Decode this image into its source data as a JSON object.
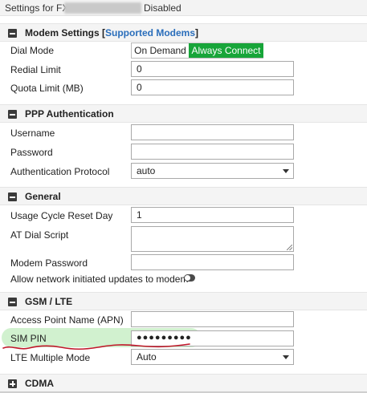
{
  "window": {
    "title_prefix": "Settings for FX",
    "title_suffix": "Disabled"
  },
  "modem_settings": {
    "title": "Modem Settings",
    "link_open": "[",
    "link_text": "Supported Modems",
    "link_close": "]",
    "dial_mode_label": "Dial Mode",
    "dial_mode_options": [
      "On Demand",
      "Always Connect"
    ],
    "dial_mode_selected": "Always Connect",
    "redial_limit_label": "Redial Limit",
    "redial_limit_value": "0",
    "quota_limit_label": "Quota Limit (MB)",
    "quota_limit_value": "0"
  },
  "ppp_auth": {
    "title": "PPP Authentication",
    "username_label": "Username",
    "username_value": "",
    "password_label": "Password",
    "password_value": "",
    "auth_protocol_label": "Authentication Protocol",
    "auth_protocol_value": "auto"
  },
  "general": {
    "title": "General",
    "usage_cycle_label": "Usage Cycle Reset Day",
    "usage_cycle_value": "1",
    "at_dial_label": "AT Dial Script",
    "at_dial_value": "",
    "modem_password_label": "Modem Password",
    "modem_password_value": "",
    "allow_updates_label": "Allow network initiated updates to modem",
    "allow_updates_enabled": false
  },
  "gsm_lte": {
    "title": "GSM / LTE",
    "apn_label": "Access Point Name (APN)",
    "apn_value": "",
    "sim_pin_label": "SIM PIN",
    "sim_pin_value": "●●●●●●●●●",
    "lte_mode_label": "LTE Multiple Mode",
    "lte_mode_value": "Auto"
  },
  "cdma": {
    "title": "CDMA",
    "collapsed": true
  },
  "colors": {
    "accent_green": "#17a539",
    "link_blue": "#2a6ebb",
    "highlight_green": "#c9efc7",
    "annotation_red": "#c0182a"
  },
  "icons": {
    "section_expanded": "collapse-minus-icon",
    "section_collapsed": "expand-plus-icon",
    "select_arrow": "caret-down-icon"
  }
}
